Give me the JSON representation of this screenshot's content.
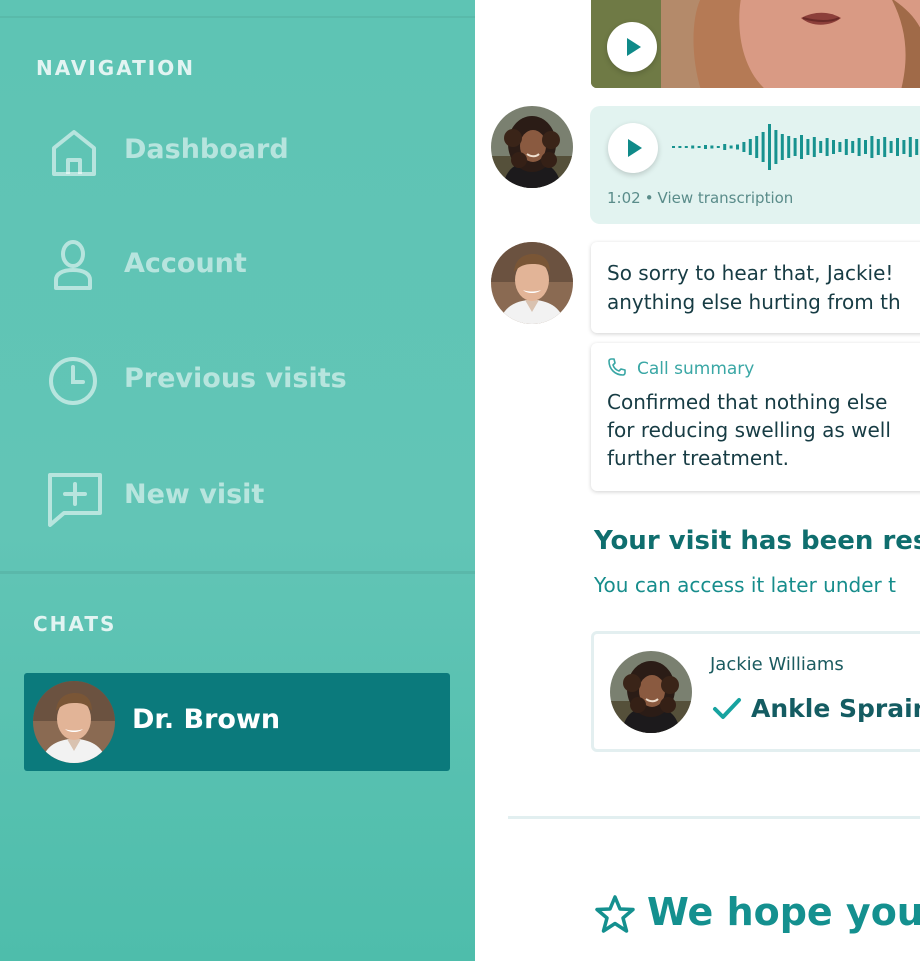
{
  "sidebar": {
    "navigation_title": "NAVIGATION",
    "nav_items": [
      {
        "label": "Dashboard",
        "icon": "home-icon"
      },
      {
        "label": "Account",
        "icon": "user-icon"
      },
      {
        "label": "Previous visits",
        "icon": "clock-icon"
      },
      {
        "label": "New visit",
        "icon": "chat-plus-icon"
      }
    ],
    "chats_title": "CHATS",
    "chats": [
      {
        "name": "Dr. Brown",
        "active": true,
        "avatar": "doctor-avatar"
      }
    ]
  },
  "chat": {
    "video_message": {
      "play_icon": "play-icon",
      "thumbnail": "patient-video-thumbnail"
    },
    "audio_message": {
      "duration": "1:02",
      "separator": "•",
      "transcription_link": "View transcription",
      "play_icon": "play-icon"
    },
    "doctor_message": {
      "lines": [
        "So sorry to hear that, Jackie!",
        "anything else hurting from th"
      ]
    },
    "call_summary": {
      "title": "Call summary",
      "icon": "phone-icon",
      "lines": [
        "Confirmed that nothing else",
        "for reducing swelling as well",
        "further treatment."
      ]
    },
    "resolved": {
      "title": "Your visit has been reso",
      "subtitle": "You can access it later under t"
    },
    "visit_card": {
      "patient_name": "Jackie Williams",
      "diagnosis": "Ankle Sprain",
      "status_icon": "checkmark-icon"
    },
    "feedback": {
      "text": "We hope you e",
      "icon": "star-icon"
    }
  },
  "colors": {
    "sidebar_bg": "#5ec4b4",
    "active_chat_bg": "#0b7a7c",
    "accent": "#14908f",
    "audio_bubble_bg": "#e2f3f0"
  }
}
